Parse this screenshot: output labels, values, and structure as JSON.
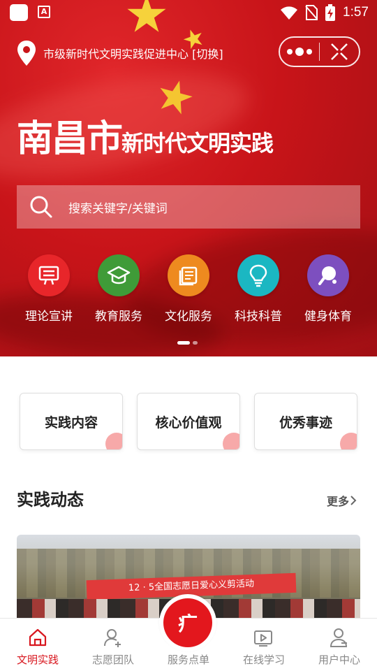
{
  "status_bar": {
    "time": "1:57",
    "notif_app_letter": "A"
  },
  "header": {
    "location_label": "市级新时代文明实践促进中心 [切换]",
    "title_big": "南昌市",
    "title_small": "新时代文明实践"
  },
  "search": {
    "placeholder": "搜索关键字/关键词"
  },
  "categories": [
    {
      "label": "理论宣讲",
      "color": "#e8262a",
      "icon": "lecture-icon"
    },
    {
      "label": "教育服务",
      "color": "#3f9b38",
      "icon": "graduation-cap-icon"
    },
    {
      "label": "文化服务",
      "color": "#ee8a1f",
      "icon": "document-icon"
    },
    {
      "label": "科技科普",
      "color": "#1bb7c2",
      "icon": "lightbulb-icon"
    },
    {
      "label": "健身体育",
      "color": "#7d4fbf",
      "icon": "ping-pong-icon"
    }
  ],
  "quick_links": [
    {
      "label": "实践内容"
    },
    {
      "label": "核心价值观"
    },
    {
      "label": "优秀事迹"
    }
  ],
  "section": {
    "title": "实践动态",
    "more_label": "更多"
  },
  "photo": {
    "banner_text": "12 · 5全国志愿日爱心义剪活动"
  },
  "tabs": [
    {
      "label": "文明实践",
      "icon": "home-icon",
      "active": true
    },
    {
      "label": "志愿团队",
      "icon": "user-add-icon",
      "active": false
    },
    {
      "label": "服务点单",
      "icon": "order-icon",
      "active": false
    },
    {
      "label": "在线学习",
      "icon": "video-play-icon",
      "active": false
    },
    {
      "label": "用户中心",
      "icon": "user-center-icon",
      "active": false
    }
  ],
  "center_button": {
    "glyph": "疒"
  },
  "colors": {
    "accent": "#d8171f",
    "hero": "#c81419",
    "tab_inactive": "#888888"
  }
}
